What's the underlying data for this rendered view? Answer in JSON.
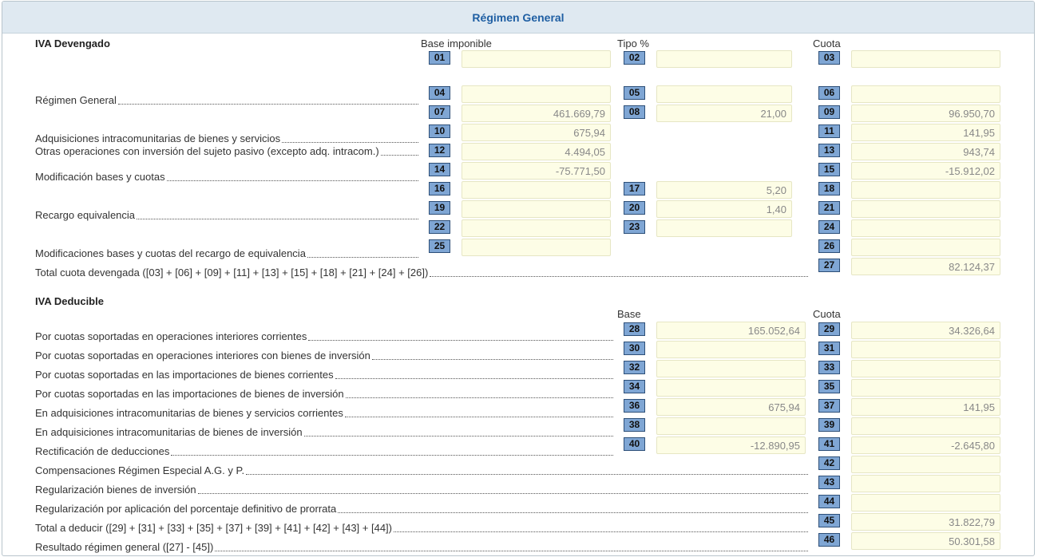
{
  "panel": {
    "title": "Régimen General"
  },
  "devengado": {
    "title": "IVA Devengado",
    "col_base": "Base imponible",
    "col_tipo": "Tipo %",
    "col_cuota": "Cuota",
    "labels": {
      "regimen_general": "Régimen General",
      "adquisiciones": "Adquisiciones intracomunitarias de bienes y servicios",
      "otras": "Otras operaciones con inversión del sujeto pasivo (excepto adq. intracom.)",
      "modificacion": "Modificación bases y cuotas",
      "recargo": "Recargo equivalencia",
      "modif_recargo": "Modificaciones bases y cuotas del recargo de equivalencia",
      "total": "Total cuota devengada ([03] + [06] + [09] + [11] + [13] + [15] + [18] + [21] + [24] + [26])"
    }
  },
  "deducible": {
    "title": "IVA Deducible",
    "col_base": "Base",
    "col_cuota": "Cuota",
    "labels": {
      "interiores_corrientes": "Por cuotas soportadas en operaciones interiores corrientes",
      "interiores_inversion": "Por cuotas soportadas en operaciones interiores con bienes de inversión",
      "importaciones_corrientes": "Por cuotas soportadas en las importaciones de bienes corrientes",
      "importaciones_inversion": "Por cuotas soportadas en las importaciones de bienes de inversión",
      "intracom_corrientes": "En adquisiciones intracomunitarias de bienes y servicios corrientes",
      "intracom_inversion": "En adquisiciones intracomunitarias de bienes de inversión",
      "rectificacion": "Rectificación de deducciones",
      "compensaciones": "Compensaciones Régimen Especial A.G. y P.",
      "regularizacion_inversion": "Regularización bienes de inversión",
      "regularizacion_prorrata": "Regularización por aplicación del porcentaje definitivo de prorrata",
      "total": "Total a deducir ([29] + [31] + [33] + [35] + [37] + [39] + [41] + [42] + [43] + [44])",
      "resultado": "Resultado régimen general ([27] - [45])"
    }
  },
  "boxes": {
    "b01": {
      "num": "01",
      "value": ""
    },
    "b02": {
      "num": "02",
      "value": ""
    },
    "b03": {
      "num": "03",
      "value": ""
    },
    "b04": {
      "num": "04",
      "value": ""
    },
    "b05": {
      "num": "05",
      "value": ""
    },
    "b06": {
      "num": "06",
      "value": ""
    },
    "b07": {
      "num": "07",
      "value": "461.669,79"
    },
    "b08": {
      "num": "08",
      "value": "21,00"
    },
    "b09": {
      "num": "09",
      "value": "96.950,70"
    },
    "b10": {
      "num": "10",
      "value": "675,94"
    },
    "b11": {
      "num": "11",
      "value": "141,95"
    },
    "b12": {
      "num": "12",
      "value": "4.494,05"
    },
    "b13": {
      "num": "13",
      "value": "943,74"
    },
    "b14": {
      "num": "14",
      "value": "-75.771,50"
    },
    "b15": {
      "num": "15",
      "value": "-15.912,02"
    },
    "b16": {
      "num": "16",
      "value": ""
    },
    "b17": {
      "num": "17",
      "value": "5,20"
    },
    "b18": {
      "num": "18",
      "value": ""
    },
    "b19": {
      "num": "19",
      "value": ""
    },
    "b20": {
      "num": "20",
      "value": "1,40"
    },
    "b21": {
      "num": "21",
      "value": ""
    },
    "b22": {
      "num": "22",
      "value": ""
    },
    "b23": {
      "num": "23",
      "value": ""
    },
    "b24": {
      "num": "24",
      "value": ""
    },
    "b25": {
      "num": "25",
      "value": ""
    },
    "b26": {
      "num": "26",
      "value": ""
    },
    "b27": {
      "num": "27",
      "value": "82.124,37"
    },
    "b28": {
      "num": "28",
      "value": "165.052,64"
    },
    "b29": {
      "num": "29",
      "value": "34.326,64"
    },
    "b30": {
      "num": "30",
      "value": ""
    },
    "b31": {
      "num": "31",
      "value": ""
    },
    "b32": {
      "num": "32",
      "value": ""
    },
    "b33": {
      "num": "33",
      "value": ""
    },
    "b34": {
      "num": "34",
      "value": ""
    },
    "b35": {
      "num": "35",
      "value": ""
    },
    "b36": {
      "num": "36",
      "value": "675,94"
    },
    "b37": {
      "num": "37",
      "value": "141,95"
    },
    "b38": {
      "num": "38",
      "value": ""
    },
    "b39": {
      "num": "39",
      "value": ""
    },
    "b40": {
      "num": "40",
      "value": "-12.890,95"
    },
    "b41": {
      "num": "41",
      "value": "-2.645,80"
    },
    "b42": {
      "num": "42",
      "value": ""
    },
    "b43": {
      "num": "43",
      "value": ""
    },
    "b44": {
      "num": "44",
      "value": ""
    },
    "b45": {
      "num": "45",
      "value": "31.822,79"
    },
    "b46": {
      "num": "46",
      "value": "50.301,58"
    }
  }
}
